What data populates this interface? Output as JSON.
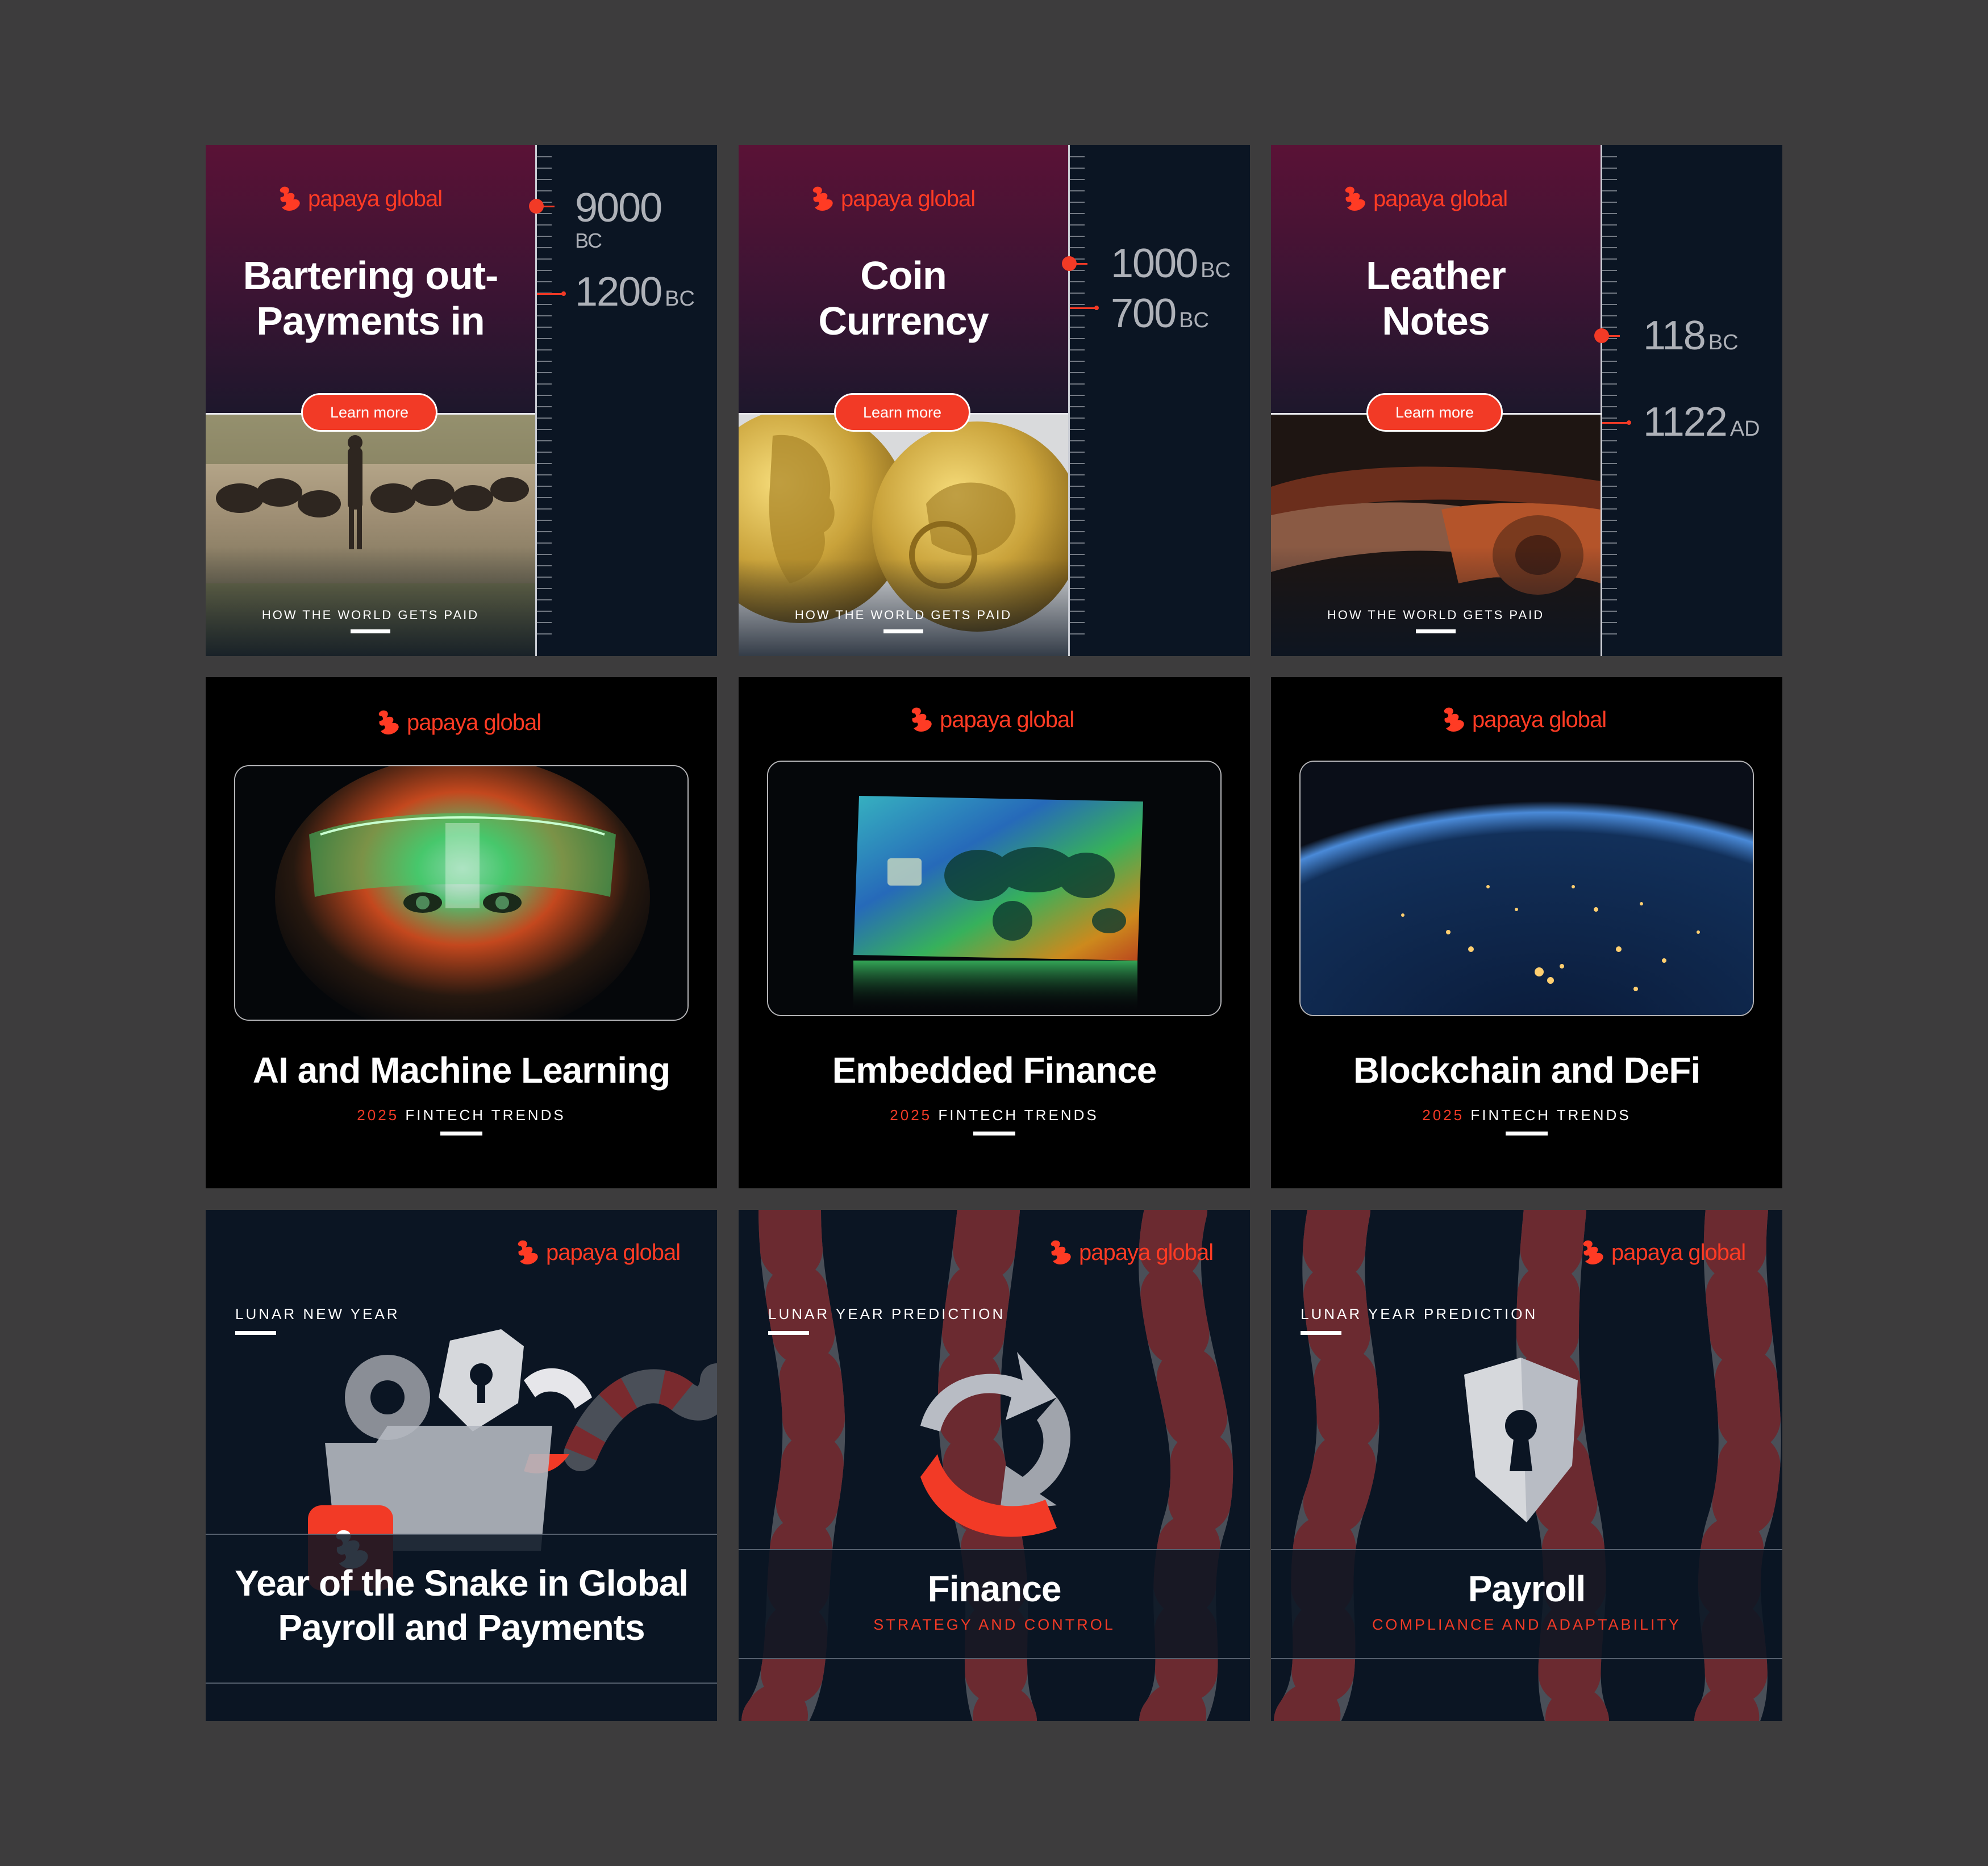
{
  "brand": {
    "name": "papaya global",
    "color": "#f23a26"
  },
  "timeline_cards": [
    {
      "title_line1": "Bartering out-",
      "title_line2": "Payments in",
      "button": "Learn more",
      "footer": "HOW THE WORLD GETS PAID",
      "dates": [
        {
          "num": "9000",
          "era": "BC"
        },
        {
          "num": "1200",
          "era": "BC"
        }
      ]
    },
    {
      "title_line1": "Coin",
      "title_line2": "Currency",
      "button": "Learn more",
      "footer": "HOW THE WORLD GETS PAID",
      "dates": [
        {
          "num": "1000",
          "era": "BC"
        },
        {
          "num": "700",
          "era": "BC"
        }
      ]
    },
    {
      "title_line1": "Leather",
      "title_line2": "Notes",
      "button": "Learn more",
      "footer": "HOW THE WORLD GETS PAID",
      "dates": [
        {
          "num": "118",
          "era": "BC"
        },
        {
          "num": "1122",
          "era": "AD"
        }
      ]
    }
  ],
  "trend_cards": [
    {
      "title": "AI and Machine Learning",
      "year": "2025",
      "label": "FINTECH TRENDS"
    },
    {
      "title": "Embedded Finance",
      "year": "2025",
      "label": "FINTECH TRENDS"
    },
    {
      "title": "Blockchain and DeFi",
      "year": "2025",
      "label": "FINTECH TRENDS"
    }
  ],
  "lunar_cards": [
    {
      "kicker": "LUNAR NEW YEAR",
      "title_line1": "Year of the Snake in Global",
      "title_line2": "Payroll and Payments"
    },
    {
      "kicker": "LUNAR YEAR PREDICTION",
      "title": "Finance",
      "subtitle": "STRATEGY AND CONTROL"
    },
    {
      "kicker": "LUNAR YEAR PREDICTION",
      "title": "Payroll",
      "subtitle": "COMPLIANCE AND ADAPTABILITY"
    }
  ]
}
